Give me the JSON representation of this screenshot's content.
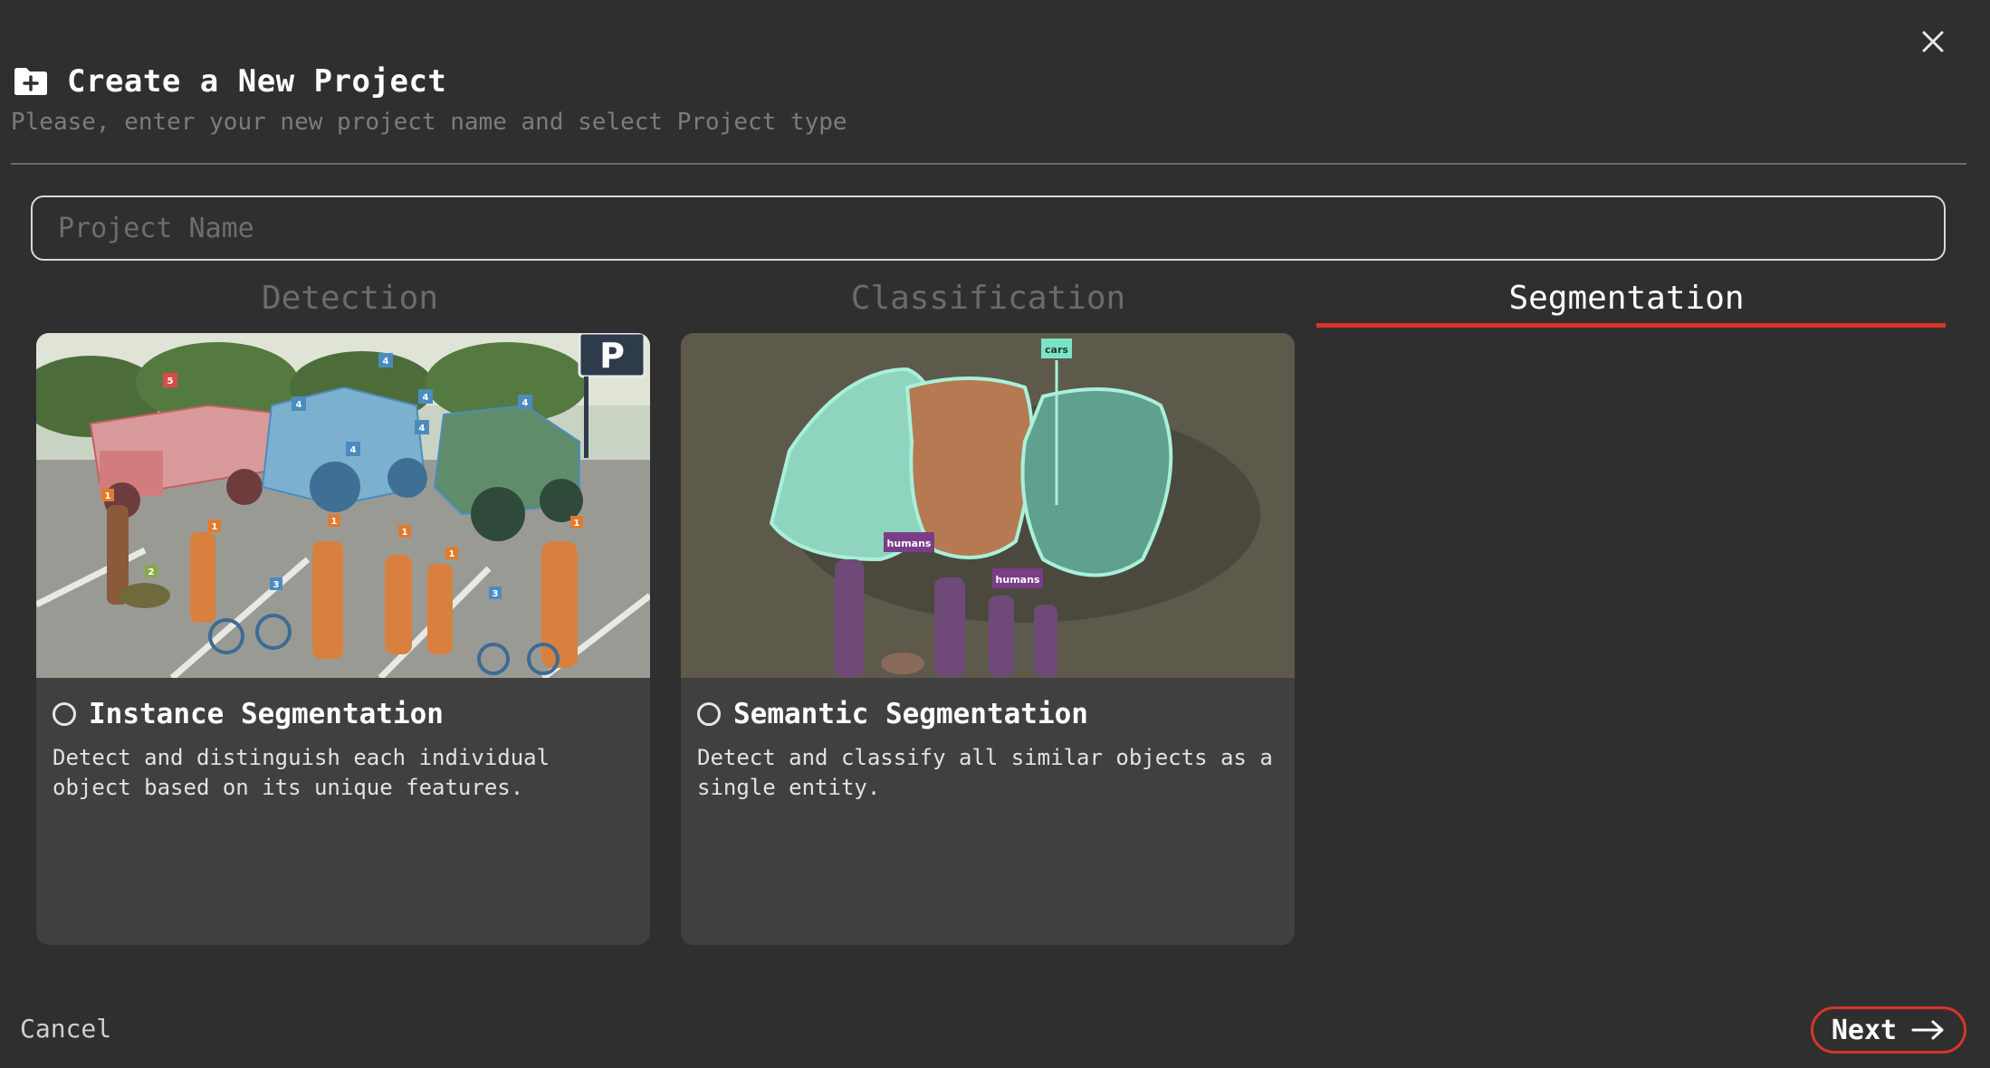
{
  "dialog": {
    "title": "Create a New Project",
    "subtitle": "Please, enter your new project name and select Project type",
    "title_icon": "folder-plus-icon",
    "close_icon": "close-icon"
  },
  "project_name": {
    "value": "",
    "placeholder": "Project Name"
  },
  "tabs": [
    {
      "label": "Detection",
      "active": false
    },
    {
      "label": "Classification",
      "active": false
    },
    {
      "label": "Segmentation",
      "active": true
    }
  ],
  "cards": [
    {
      "title": "Instance Segmentation",
      "description": "Detect and distinguish each individual object based on its unique features.",
      "selected": false,
      "image_labels": [
        "5",
        "4",
        "4",
        "4",
        "4",
        "4",
        "4",
        "1",
        "1",
        "1",
        "1",
        "1",
        "1",
        "2",
        "3",
        "3"
      ]
    },
    {
      "title": "Semantic Segmentation",
      "description": "Detect and classify all similar objects as a single entity.",
      "selected": false,
      "image_labels": [
        "cars",
        "humans",
        "humans"
      ]
    }
  ],
  "footer": {
    "cancel_label": "Cancel",
    "next_label": "Next",
    "next_icon": "arrow-right-icon"
  },
  "colors": {
    "background": "#2f2f2f",
    "card": "#404040",
    "accent": "#d9342b"
  }
}
